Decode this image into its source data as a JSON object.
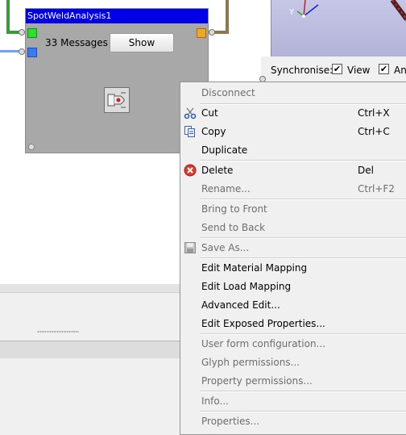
{
  "glyph": {
    "title": "SpotWeldAnalysis1",
    "messages": "33 Messages",
    "show_label": "Show"
  },
  "viewer": {
    "sync_label": "Synchronise:",
    "view_label": "View",
    "an_label": "An",
    "view_checked": true,
    "an_checked": true,
    "axis_label": "Y"
  },
  "menu": {
    "disconnect": "Disconnect",
    "cut": "Cut",
    "cut_shortcut": "Ctrl+X",
    "copy": "Copy",
    "copy_shortcut": "Ctrl+C",
    "duplicate": "Duplicate",
    "delete": "Delete",
    "delete_shortcut": "Del",
    "rename": "Rename...",
    "rename_shortcut": "Ctrl+F2",
    "bring_to_front": "Bring to Front",
    "send_to_back": "Send to Back",
    "save_as": "Save As...",
    "edit_material_mapping": "Edit Material Mapping",
    "edit_load_mapping": "Edit Load Mapping",
    "advanced_edit": "Advanced Edit...",
    "edit_exposed_properties": "Edit Exposed Properties...",
    "user_form_configuration": "User form configuration...",
    "glyph_permissions": "Glyph permissions...",
    "property_permissions": "Property permissions...",
    "info": "Info...",
    "properties": "Properties..."
  },
  "colors": {
    "glyph_title_bg": "#0000e6",
    "port_green": "#2ee02e",
    "port_blue": "#3a7bf5",
    "port_orange": "#f2a626",
    "wire_green": "#3a9a3a",
    "wire_blue": "#6aa0ff",
    "wire_brown": "#8a7a4a",
    "delete_red": "#e23a2a"
  }
}
